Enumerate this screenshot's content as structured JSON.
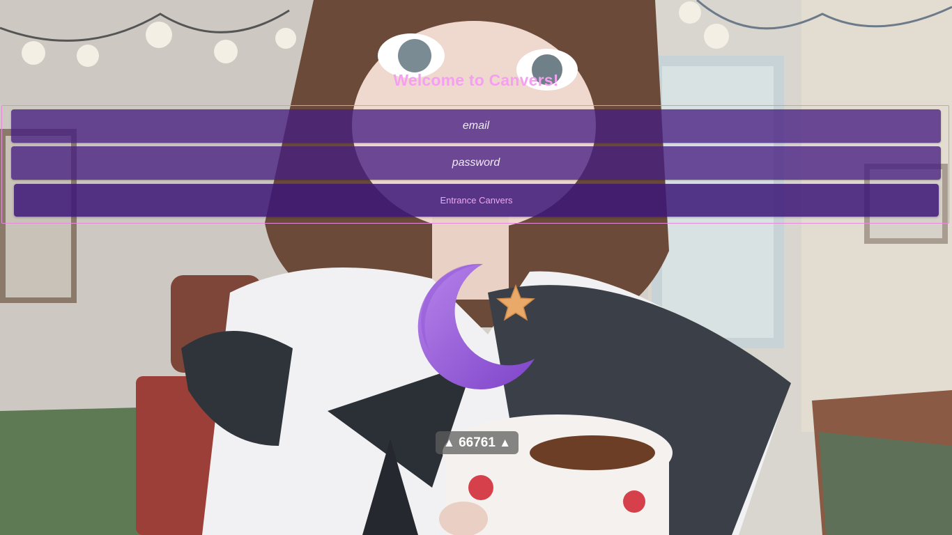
{
  "header": {
    "title": "Welcome to Canvers!"
  },
  "login_form": {
    "email_placeholder": "email",
    "password_placeholder": "password",
    "submit_label": "Entrance Canvers"
  },
  "counter": {
    "left_arrow": "▲",
    "value": "66761",
    "right_arrow": "▲"
  },
  "colors": {
    "title": "#f59ff0",
    "form_border": "#e58ad9",
    "field_bg": "#461e82",
    "button_text": "#f0a7ef",
    "moon": "#9a5fd6",
    "star": "#e9a968"
  },
  "icons": {
    "logo": "crescent-moon-star-icon"
  }
}
